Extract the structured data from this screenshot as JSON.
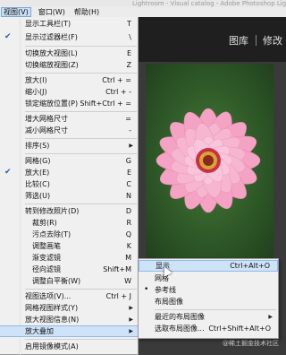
{
  "title_bar": {
    "text": "Lightroom - Visual catalog - Adobe Photoshop Lightroom"
  },
  "menubar": {
    "items": [
      {
        "label": "视图(V)",
        "active": true
      },
      {
        "label": "窗口(W)",
        "active": false
      },
      {
        "label": "帮助(H)",
        "active": false
      }
    ]
  },
  "modules": {
    "library": "图库",
    "develop": "修改"
  },
  "view_menu": {
    "items": [
      {
        "label": "显示工具栏(T)",
        "shortcut": "T"
      },
      {
        "label": "显示过滤器栏(F)",
        "shortcut": "\\",
        "checked": true
      },
      {
        "label": "切换放大视图(L)",
        "shortcut": "E"
      },
      {
        "label": "切换缩放视图(Z)",
        "shortcut": "Z"
      },
      {
        "label": "放大(I)",
        "shortcut": "Ctrl + ="
      },
      {
        "label": "缩小(J)",
        "shortcut": "Ctrl + -"
      },
      {
        "label": "锁定缩放位置(P)",
        "shortcut": "Shift+Ctrl + ="
      },
      {
        "label": "增大网格尺寸",
        "shortcut": "="
      },
      {
        "label": "减小网格尺寸",
        "shortcut": "-"
      },
      {
        "label": "排序(S)",
        "submenu": true
      },
      {
        "label": "网格(G)",
        "shortcut": "G"
      },
      {
        "label": "放大(E)",
        "shortcut": "E",
        "checked": true
      },
      {
        "label": "比较(C)",
        "shortcut": "C"
      },
      {
        "label": "筛选(U)",
        "shortcut": "N"
      },
      {
        "label": "转到修改照片(D)",
        "shortcut": "D"
      },
      {
        "label": "裁剪(R)",
        "shortcut": "R",
        "indent": true
      },
      {
        "label": "污点去除(T)",
        "shortcut": "Q",
        "indent": true
      },
      {
        "label": "调整画笔",
        "shortcut": "K",
        "indent": true
      },
      {
        "label": "渐变滤镜",
        "shortcut": "M",
        "indent": true
      },
      {
        "label": "径向滤镜",
        "shortcut": "Shift+M",
        "indent": true
      },
      {
        "label": "调整白平衡(W)",
        "shortcut": "W",
        "indent": true
      },
      {
        "label": "视图选项(V)...",
        "shortcut": "Ctrl + J"
      },
      {
        "label": "网格视图样式(Y)",
        "submenu": true
      },
      {
        "label": "放大视图信息(N)",
        "submenu": true
      },
      {
        "label": "放大叠加",
        "submenu": true,
        "highlighted": true
      },
      {
        "label": "启用镜像模式(A)"
      }
    ]
  },
  "loupe_overlay_submenu": {
    "items": [
      {
        "label": "显示",
        "shortcut": "Ctrl+Alt+O",
        "highlighted": true
      },
      {
        "label": "网格",
        "mark": ""
      },
      {
        "label": "参考线",
        "mark": "•"
      },
      {
        "label": "布局图像",
        "mark": ""
      },
      {
        "label": "最近的布局图像",
        "submenu": true
      },
      {
        "label": "选取布局图像...",
        "shortcut": "Ctrl+Shift+Alt+O"
      }
    ]
  },
  "watermark": "@稀土掘金技术社区",
  "colors": {
    "highlight": "#cfe3f8",
    "menu_bg": "#f0f0f0",
    "check": "#1f5fb3"
  }
}
